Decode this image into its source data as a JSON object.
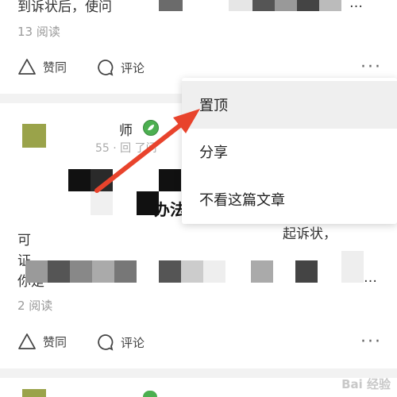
{
  "post1": {
    "text_line": "到诉状后，使问",
    "reads": "13 阅读",
    "like_label": "赞同",
    "comment_label": "评论",
    "more": "···"
  },
  "post2": {
    "author": "师",
    "time": "55 · 回   了问",
    "title_fragment": "办法",
    "body_line1": "可",
    "body_line1_end": "起诉状，",
    "body_line2": "证",
    "body_line3": "你是",
    "reads": "2 阅读",
    "like_label": "赞同",
    "comment_label": "评论",
    "more": "···"
  },
  "menu": {
    "items": [
      "置顶",
      "分享",
      "不看这篇文章"
    ]
  },
  "watermark": "Bai 经验",
  "colors": {
    "arrow": "#e8432c",
    "verified": "#4caf50",
    "avatar": "#9aa34a"
  }
}
